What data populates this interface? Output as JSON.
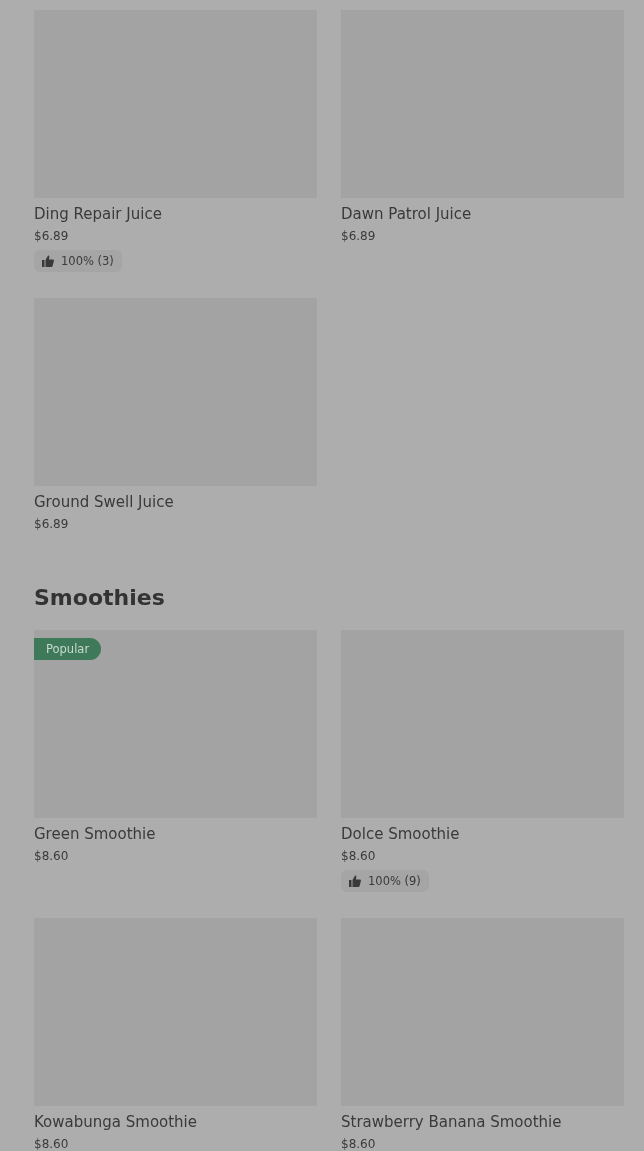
{
  "sections": [
    {
      "items": [
        {
          "name": "Ding Repair Juice",
          "price": "$6.89",
          "rating": "100% (3)"
        },
        {
          "name": "Dawn Patrol Juice",
          "price": "$6.89"
        },
        {
          "name": "Ground Swell Juice",
          "price": "$6.89"
        }
      ]
    },
    {
      "title": "Smoothies",
      "items": [
        {
          "name": "Green Smoothie",
          "price": "$8.60",
          "badge": "Popular"
        },
        {
          "name": "Dolce Smoothie",
          "price": "$8.60",
          "rating": "100% (9)"
        },
        {
          "name": "Kowabunga Smoothie",
          "price": "$8.60"
        },
        {
          "name": "Strawberry Banana Smoothie",
          "price": "$8.60"
        }
      ]
    }
  ]
}
